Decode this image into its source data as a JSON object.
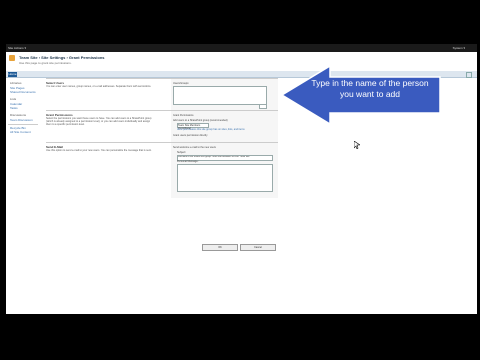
{
  "topbar": {
    "site_actions": "Site Actions ▾",
    "user": "System ▾"
  },
  "header": {
    "breadcrumb": "Team Site › Site Settings › Grant Permissions",
    "subtitle": "Use this page to grant site permissions."
  },
  "nav": {
    "home": "Home"
  },
  "leftnav": {
    "libraries": "Libraries",
    "site_pages": "Site Pages",
    "shared_docs": "Shared Documents",
    "lists": "Lists",
    "calendar": "Calendar",
    "tasks": "Tasks",
    "discussions": "Discussions",
    "team_discussion": "Team Discussion",
    "recycle_bin": "Recycle Bin",
    "all_site_content": "All Site Content"
  },
  "sections": {
    "users": {
      "title": "Select Users",
      "desc": "You can enter user names, group names, or e-mail addresses. Separate them with semicolons."
    },
    "perms": {
      "title": "Grant Permissions",
      "desc": "Select the permissions you want these users to have. You can add users to a SharePoint group (which is already assigned to a permission level), or you can add users individually and assign them to a specific permission level."
    },
    "mail": {
      "title": "Send E-Mail",
      "desc": "Use this option to send e-mail to your new users. You can personalize the message that is sent."
    },
    "users_label": "Users/Groups:",
    "perm_label": "Grant Permissions",
    "opt_group": "Add users to a SharePoint group (recommended)",
    "group_value": "Team Site Members [Contribute]",
    "group_note": "View permissions this site group has on sites, lists, and items",
    "opt_direct": "Grant users permission directly",
    "send_mail": "Send welcome e-mail to the new users",
    "subject_label": "Subject:",
    "subject_value": "Welcome to the SharePoint group: Team Site Members for site: Team Site",
    "message_label": "Personal Message:",
    "ok": "OK",
    "cancel": "Cancel"
  },
  "overlay": {
    "tip": "Type in the name of the person you want to add",
    "arrow_color": "#3a5bbf"
  }
}
